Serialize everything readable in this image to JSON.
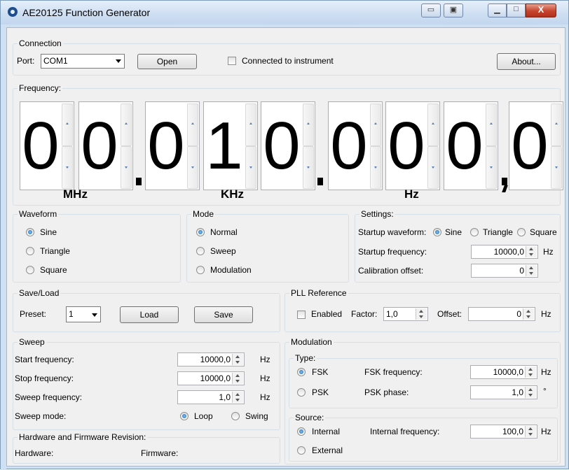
{
  "window": {
    "title": "AE20125 Function Generator",
    "close_glyph": "X"
  },
  "connection": {
    "group": "Connection",
    "port_label": "Port:",
    "port_value": "COM1",
    "open_button": "Open",
    "connected_label": "Connected to instrument",
    "connected_checked": false,
    "about_button": "About..."
  },
  "frequency": {
    "group": "Frequency:",
    "digits": [
      "0",
      "0",
      "0",
      "1",
      "0",
      "0",
      "0",
      "0",
      "0"
    ],
    "units": {
      "mhz": "MHz",
      "khz": "KHz",
      "hz": "Hz"
    }
  },
  "waveform": {
    "group": "Waveform",
    "options": [
      "Sine",
      "Triangle",
      "Square"
    ],
    "selected": "Sine"
  },
  "mode": {
    "group": "Mode",
    "options": [
      "Normal",
      "Sweep",
      "Modulation"
    ],
    "selected": "Normal"
  },
  "settings": {
    "group": "Settings:",
    "startup_waveform_label": "Startup waveform:",
    "startup_waveform_options": [
      "Sine",
      "Triangle",
      "Square"
    ],
    "startup_waveform_selected": "Sine",
    "startup_frequency_label": "Startup frequency:",
    "startup_frequency_value": "10000,0",
    "startup_frequency_unit": "Hz",
    "calibration_offset_label": "Calibration offset:",
    "calibration_offset_value": "0"
  },
  "saveload": {
    "group": "Save/Load",
    "preset_label": "Preset:",
    "preset_value": "1",
    "load_button": "Load",
    "save_button": "Save"
  },
  "pll": {
    "group": "PLL Reference",
    "enabled_label": "Enabled",
    "enabled_checked": false,
    "factor_label": "Factor:",
    "factor_value": "1,0",
    "offset_label": "Offset:",
    "offset_value": "0",
    "offset_unit": "Hz"
  },
  "sweep": {
    "group": "Sweep",
    "start_label": "Start frequency:",
    "start_value": "10000,0",
    "start_unit": "Hz",
    "stop_label": "Stop frequency:",
    "stop_value": "10000,0",
    "stop_unit": "Hz",
    "sweep_label": "Sweep frequency:",
    "sweep_value": "1,0",
    "sweep_unit": "Hz",
    "mode_label": "Sweep mode:",
    "mode_options": [
      "Loop",
      "Swing"
    ],
    "mode_selected": "Loop"
  },
  "modulation": {
    "group": "Modulation",
    "type_label": "Type:",
    "type_options": [
      "FSK",
      "PSK"
    ],
    "type_selected": "FSK",
    "fsk_label": "FSK frequency:",
    "fsk_value": "10000,0",
    "fsk_unit": "Hz",
    "psk_label": "PSK phase:",
    "psk_value": "1,0",
    "psk_unit": "°",
    "source_label": "Source:",
    "source_options": [
      "Internal",
      "External"
    ],
    "source_selected": "Internal",
    "internal_label": "Internal frequency:",
    "internal_value": "100,0",
    "internal_unit": "Hz"
  },
  "hardware": {
    "group": "Hardware and Firmware Revision:",
    "hardware_label": "Hardware:",
    "firmware_label": "Firmware:"
  }
}
